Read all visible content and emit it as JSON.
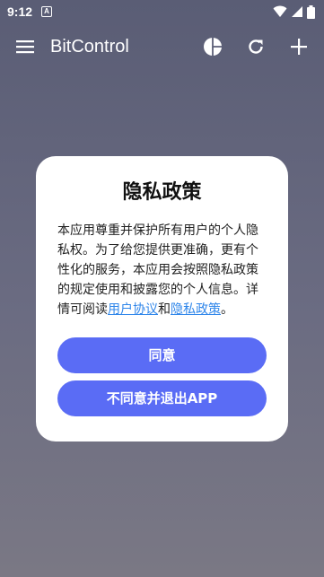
{
  "status_bar": {
    "time": "9:12",
    "app_icon_letter": "A"
  },
  "app_bar": {
    "title": "BitControl",
    "icons": [
      "menu-icon",
      "pie-chart-icon",
      "refresh-icon",
      "add-icon"
    ]
  },
  "dialog": {
    "title": "隐私政策",
    "body_text": "本应用尊重并保护所有用户的个人隐私权。为了给您提供更准确，更有个性化的服务，本应用会按照隐私政策的规定使用和披露您的个人信息。详情可阅读",
    "link_user_agreement": "用户协议",
    "connector": "和",
    "link_privacy_policy": "隐私政策",
    "end_punct": "。",
    "agree_label": "同意",
    "disagree_label": "不同意并退出APP"
  },
  "colors": {
    "accent": "#5a6cf5",
    "link": "#2f86ea",
    "background_top": "#5a5d75",
    "background_bottom": "#7a7884"
  }
}
